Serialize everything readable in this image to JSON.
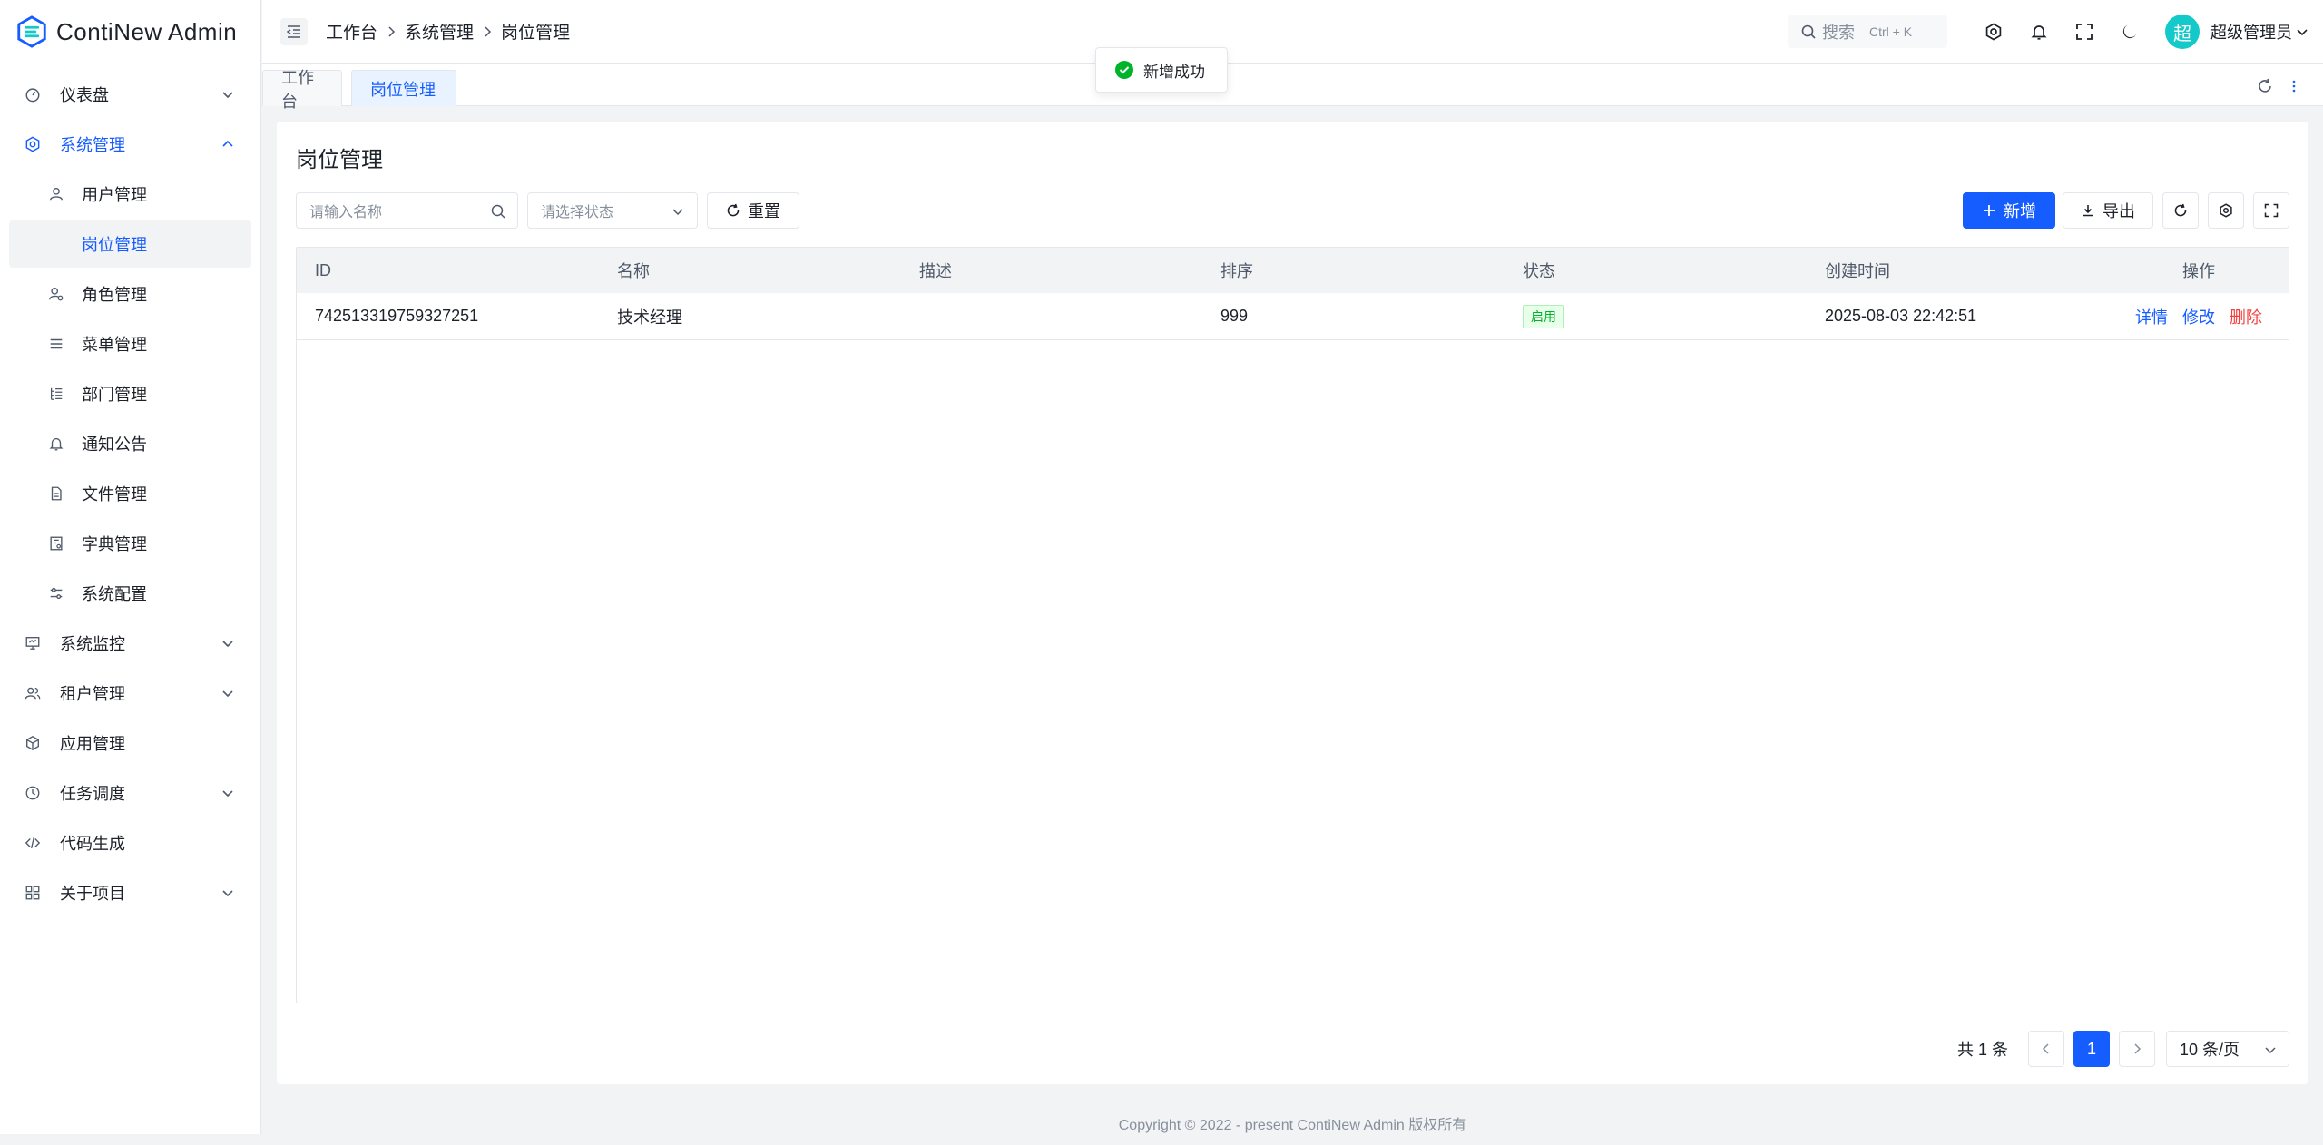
{
  "app": {
    "title": "ContiNew Admin"
  },
  "sidebar": {
    "items": [
      {
        "label": "仪表盘",
        "icon": "dashboard-icon",
        "has_arrow": true,
        "arrow": "down"
      },
      {
        "label": "系统管理",
        "icon": "gear-icon",
        "has_arrow": true,
        "arrow": "up",
        "open": true
      },
      {
        "label": "用户管理",
        "icon": "user-icon",
        "sub": true
      },
      {
        "label": "岗位管理",
        "icon": "",
        "sub": true,
        "active": true
      },
      {
        "label": "角色管理",
        "icon": "role-icon",
        "sub": true
      },
      {
        "label": "菜单管理",
        "icon": "menu-icon",
        "sub": true
      },
      {
        "label": "部门管理",
        "icon": "tree-icon",
        "sub": true
      },
      {
        "label": "通知公告",
        "icon": "bell-icon",
        "sub": true
      },
      {
        "label": "文件管理",
        "icon": "file-icon",
        "sub": true
      },
      {
        "label": "字典管理",
        "icon": "dict-icon",
        "sub": true
      },
      {
        "label": "系统配置",
        "icon": "sliders-icon",
        "sub": true
      },
      {
        "label": "系统监控",
        "icon": "monitor-icon",
        "has_arrow": true,
        "arrow": "down"
      },
      {
        "label": "租户管理",
        "icon": "tenant-icon",
        "has_arrow": true,
        "arrow": "down"
      },
      {
        "label": "应用管理",
        "icon": "cube-icon"
      },
      {
        "label": "任务调度",
        "icon": "clock-icon",
        "has_arrow": true,
        "arrow": "down"
      },
      {
        "label": "代码生成",
        "icon": "code-icon"
      },
      {
        "label": "关于项目",
        "icon": "grid-icon",
        "has_arrow": true,
        "arrow": "down"
      }
    ]
  },
  "header": {
    "breadcrumb": [
      "工作台",
      "系统管理",
      "岗位管理"
    ],
    "search_label": "搜索",
    "search_shortcut": "Ctrl + K",
    "avatar_text": "超",
    "username": "超级管理员"
  },
  "tabs": [
    {
      "label": "工作台",
      "active": false
    },
    {
      "label": "岗位管理",
      "active": true
    }
  ],
  "toast": {
    "message": "新增成功"
  },
  "page": {
    "title": "岗位管理",
    "filters": {
      "name_placeholder": "请输入名称",
      "status_placeholder": "请选择状态",
      "reset_label": "重置"
    },
    "actions": {
      "add_label": "新增",
      "export_label": "导出"
    },
    "table": {
      "columns": [
        "ID",
        "名称",
        "描述",
        "排序",
        "状态",
        "创建时间",
        "操作"
      ],
      "rows": [
        {
          "id": "742513319759327251",
          "name": "技术经理",
          "description": "",
          "sort": "999",
          "status": "启用",
          "created_at": "2025-08-03 22:42:51",
          "actions": [
            "详情",
            "修改",
            "删除"
          ]
        }
      ]
    },
    "pagination": {
      "total_text": "共 1 条",
      "current_page": "1",
      "page_size": "10 条/页"
    }
  },
  "footer": {
    "text": "Copyright © 2022 - present ContiNew Admin 版权所有"
  },
  "colors": {
    "primary": "#165dff",
    "danger": "#f53f3f",
    "success": "#00b42a",
    "avatar_bg": "#14c9c9"
  }
}
